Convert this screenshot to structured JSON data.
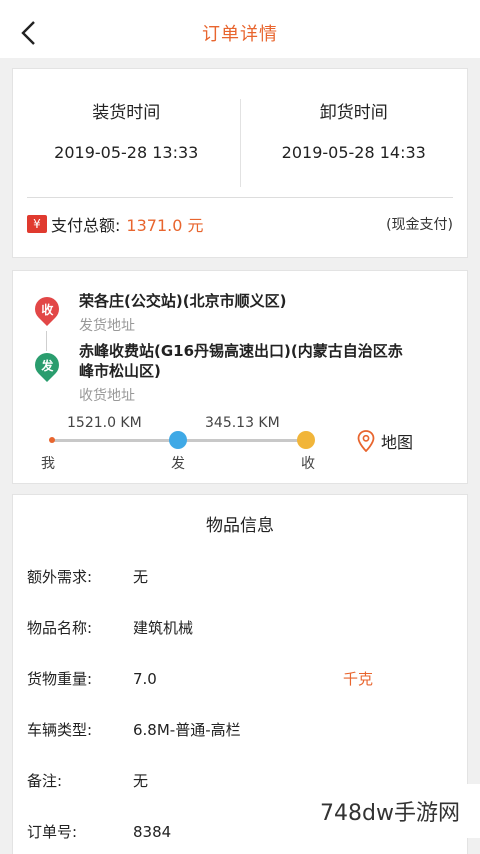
{
  "nav": {
    "title": "订单详情"
  },
  "times": {
    "load_label": "装货时间",
    "load_value": "2019-05-28 13:33",
    "unload_label": "卸货时间",
    "unload_value": "2019-05-28 14:33"
  },
  "payment": {
    "badge": "¥",
    "label": "支付总额:",
    "amount": "1371.0 元",
    "method": "(现金支付)"
  },
  "route": {
    "origin_badge": "收",
    "origin_name": "荣各庄(公交站)(北京市顺义区)",
    "origin_sub": "发货地址",
    "dest_badge": "发",
    "dest_name": "赤峰收费站(G16丹锡高速出口)(内蒙古自治区赤峰市松山区)",
    "dest_sub": "收货地址",
    "dist1": "1521.0 KM",
    "dist2": "345.13 KM",
    "node_me": "我",
    "node_send": "发",
    "node_recv": "收",
    "map_label": "地图"
  },
  "goods": {
    "title": "物品信息",
    "rows": [
      {
        "label": "额外需求:",
        "value": "无",
        "unit": ""
      },
      {
        "label": "物品名称:",
        "value": "建筑机械",
        "unit": ""
      },
      {
        "label": "货物重量:",
        "value": "7.0",
        "unit": "千克"
      },
      {
        "label": "车辆类型:",
        "value": "6.8M-普通-高栏",
        "unit": ""
      },
      {
        "label": "备注:",
        "value": "无",
        "unit": ""
      },
      {
        "label": "订单号:",
        "value": "8384",
        "unit": ""
      }
    ]
  },
  "watermark": "748dw手游网",
  "colors": {
    "accent": "#e8652e",
    "send_dot": "#3fa9e6",
    "recv_dot": "#f1b53a",
    "pin_red": "#e24747",
    "pin_green": "#2a9d6e"
  }
}
